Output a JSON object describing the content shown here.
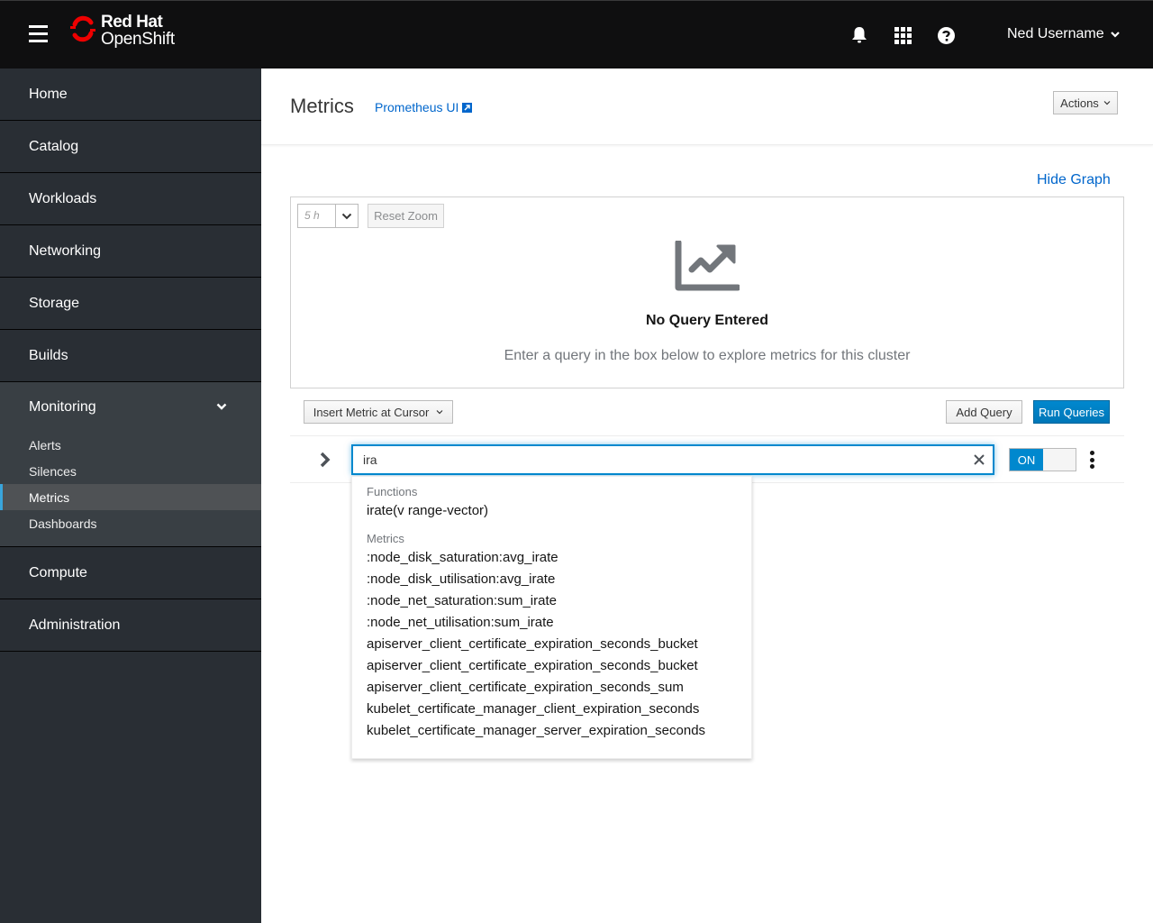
{
  "masthead": {
    "brand_line1": "Red Hat",
    "brand_line2": "OpenShift",
    "user_name": "Ned Username",
    "icons": [
      "hamburger-icon",
      "bell-icon",
      "app-launcher-grid-icon",
      "help-icon",
      "chevron-down-icon"
    ]
  },
  "sidebar": {
    "items": [
      {
        "label": "Home"
      },
      {
        "label": "Catalog"
      },
      {
        "label": "Workloads"
      },
      {
        "label": "Networking"
      },
      {
        "label": "Storage"
      },
      {
        "label": "Builds"
      }
    ],
    "monitoring": {
      "label": "Monitoring",
      "expanded": true,
      "children": [
        {
          "label": "Alerts",
          "active": false
        },
        {
          "label": "Silences",
          "active": false
        },
        {
          "label": "Metrics",
          "active": true
        },
        {
          "label": "Dashboards",
          "active": false
        }
      ]
    },
    "items_after": [
      {
        "label": "Compute"
      },
      {
        "label": "Administration"
      }
    ]
  },
  "page": {
    "title": "Metrics",
    "prometheus_link": "Prometheus UI",
    "actions_label": "Actions",
    "hide_graph_label": "Hide Graph"
  },
  "graph": {
    "span_value": "5 h",
    "reset_zoom_label": "Reset Zoom",
    "empty_title": "No Query Entered",
    "empty_message": "Enter a query in the box below to explore metrics for this cluster"
  },
  "query_toolbar": {
    "insert_metric_label": "Insert Metric at Cursor",
    "add_query_label": "Add Query",
    "run_queries_label": "Run Queries"
  },
  "query": {
    "value": "ira",
    "toggle_label": "ON",
    "toggle_on": true
  },
  "autocomplete": {
    "functions_header": "Functions",
    "functions": [
      "irate(v range-vector)"
    ],
    "metrics_header": "Metrics",
    "metrics": [
      ":node_disk_saturation:avg_irate",
      ":node_disk_utilisation:avg_irate",
      ":node_net_saturation:sum_irate",
      ":node_net_utilisation:sum_irate",
      "apiserver_client_certificate_expiration_seconds_bucket",
      "apiserver_client_certificate_expiration_seconds_bucket",
      "apiserver_client_certificate_expiration_seconds_sum",
      "kubelet_certificate_manager_client_expiration_seconds",
      "kubelet_certificate_manager_server_expiration_seconds"
    ]
  },
  "colors": {
    "masthead_bg": "#0f0f10",
    "sidebar_bg": "#292e34",
    "sidebar_section_bg": "#393f44",
    "active_item_bg": "#4f5255",
    "active_indicator": "#39a5dc",
    "link": "#0066cc",
    "primary": "#0088ce",
    "brand_red": "#ee0000"
  }
}
